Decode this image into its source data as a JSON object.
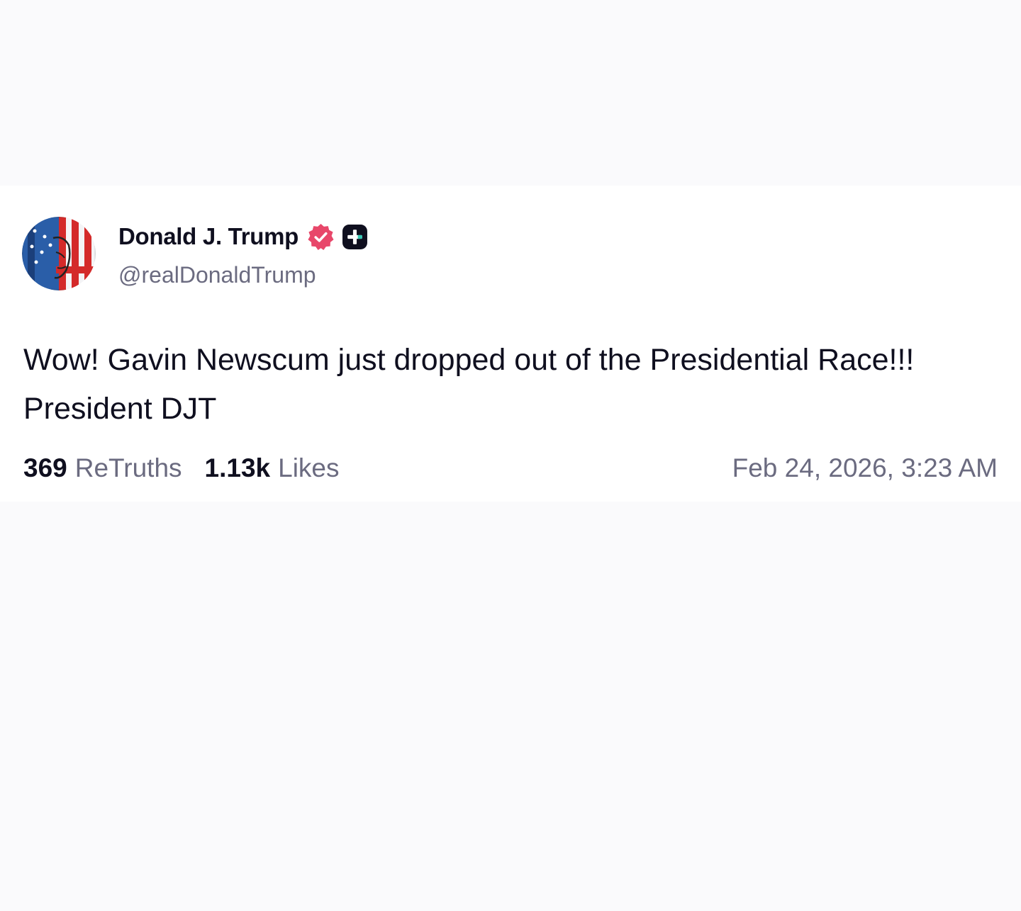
{
  "post": {
    "author": {
      "display_name": "Donald J. Trump",
      "handle": "@realDonaldTrump",
      "verified": true,
      "verified_badge_color": "#e8476a",
      "avatar_icon": "flag-portrait-avatar",
      "plus_badge_icon": "plus-badge-icon"
    },
    "text": "Wow! Gavin Newscum just dropped out of the Presidential Race!!! President DJT",
    "stats": {
      "retruths_count": "369",
      "retruths_label": "ReTruths",
      "likes_count": "1.13k",
      "likes_label": "Likes"
    },
    "timestamp": "Feb 24, 2026, 3:23 AM"
  },
  "colors": {
    "background": "#fafafc",
    "card": "#ffffff",
    "text_primary": "#0f0f1f",
    "text_secondary": "#6b6b80",
    "verified": "#e8476a"
  }
}
